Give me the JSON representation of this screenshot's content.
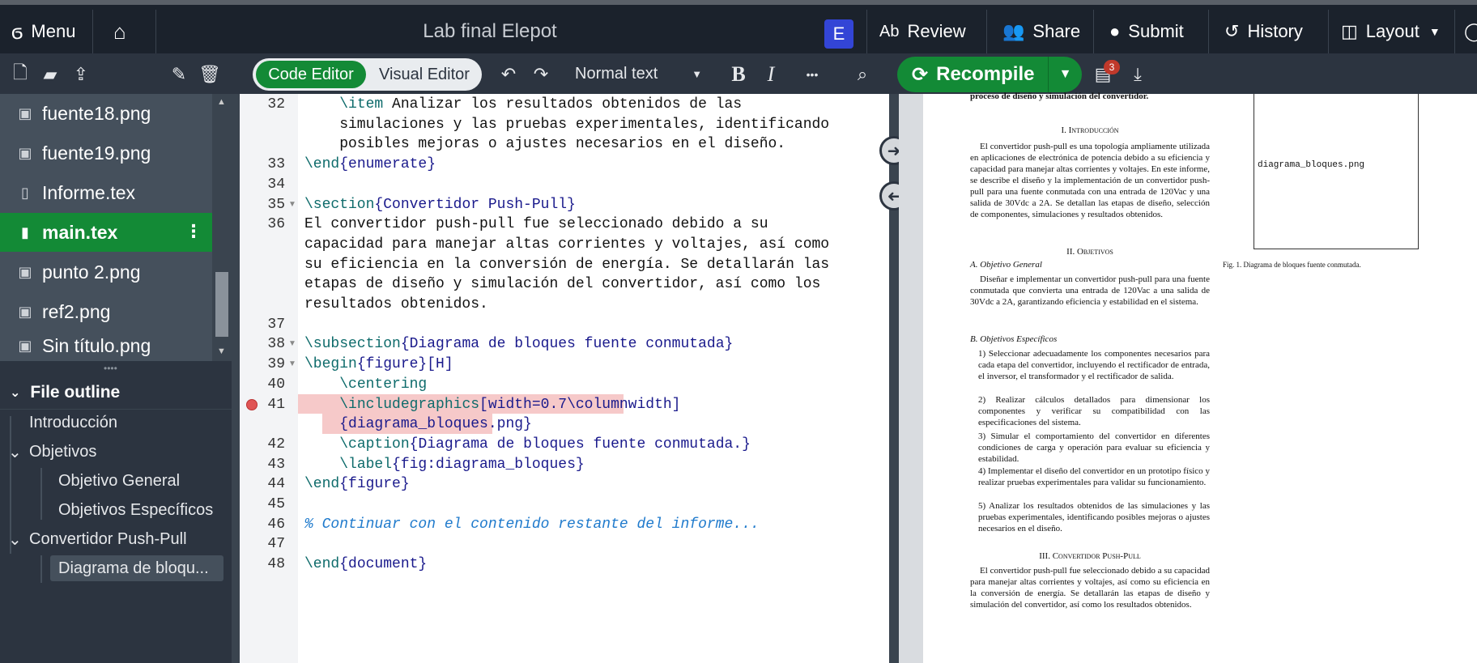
{
  "topbar": {
    "menu_label": "Menu",
    "title": "Lab final Elepot",
    "avatar_letter": "E",
    "review": "Review",
    "share": "Share",
    "submit": "Submit",
    "history": "History",
    "layout": "Layout"
  },
  "toolbar": {
    "code_editor": "Code Editor",
    "visual_editor": "Visual Editor",
    "style_select": "Normal text",
    "bold": "B",
    "italic": "I",
    "more": "•••",
    "recompile": "Recompile",
    "log_badge": "3"
  },
  "files": [
    {
      "name": "fuente18.png",
      "type": "image"
    },
    {
      "name": "fuente19.png",
      "type": "image"
    },
    {
      "name": "Informe.tex",
      "type": "doc"
    },
    {
      "name": "main.tex",
      "type": "doc",
      "selected": true
    },
    {
      "name": "punto 2.png",
      "type": "image"
    },
    {
      "name": "ref2.png",
      "type": "image"
    },
    {
      "name": "Sin título.png",
      "type": "image"
    }
  ],
  "outline": {
    "header": "File outline",
    "items": [
      {
        "label": "Introducción",
        "level": 1
      },
      {
        "label": "Objetivos",
        "level": 1
      },
      {
        "label": "Objetivo General",
        "level": 2
      },
      {
        "label": "Objetivos Específicos",
        "level": 2
      },
      {
        "label": "Convertidor Push-Pull",
        "level": 1
      },
      {
        "label": "Diagrama de bloqu...",
        "level": 2,
        "selected": true
      }
    ]
  },
  "editor": {
    "lines": [
      {
        "n": "32",
        "t1": "    ",
        "k": "\\item",
        "t2": " Analizar los resultados obtenidos de las"
      },
      {
        "n": "",
        "t1": "    simulaciones y las pruebas experimentales, identificando"
      },
      {
        "n": "",
        "t1": "    posibles mejoras o ajustes necesarios en el diseño."
      },
      {
        "n": "33",
        "k": "\\end",
        "t1": "",
        "a": "{enumerate}"
      },
      {
        "n": "34"
      },
      {
        "n": "35",
        "k": "\\section",
        "a": "{Convertidor Push-Pull}"
      },
      {
        "n": "36",
        "t1": "El convertidor push-pull fue seleccionado debido a su"
      },
      {
        "n": "",
        "t1": "capacidad para manejar altas corrientes y voltajes, así como"
      },
      {
        "n": "",
        "t1": "su eficiencia en la conversión de energía. Se detallarán las"
      },
      {
        "n": "",
        "t1": "etapas de diseño y simulación del convertidor, así como los"
      },
      {
        "n": "",
        "t1": "resultados obtenidos."
      },
      {
        "n": "37"
      },
      {
        "n": "38",
        "k": "\\subsection",
        "a": "{Diagrama de bloques fuente conmutada}"
      },
      {
        "n": "39",
        "k": "\\begin",
        "a": "{figure}[H]"
      },
      {
        "n": "40",
        "t1": "    ",
        "k": "\\centering"
      },
      {
        "n": "41",
        "t1": "    ",
        "k": "\\includegraphics",
        "a": "[width=0.7\\columnwidth]"
      },
      {
        "n": "",
        "t1": "    ",
        "a": "{diagrama_bloques.png}"
      },
      {
        "n": "42",
        "t1": "    ",
        "k": "\\caption",
        "a": "{Diagrama de bloques fuente conmutada.}"
      },
      {
        "n": "43",
        "t1": "    ",
        "k": "\\label",
        "a": "{fig:diagrama_bloques}"
      },
      {
        "n": "44",
        "k": "\\end",
        "a": "{figure}"
      },
      {
        "n": "45"
      },
      {
        "n": "46",
        "c": "% Continuar con el contenido restante del informe..."
      },
      {
        "n": "47"
      },
      {
        "n": "48",
        "k": "\\end",
        "a": "{document}"
      }
    ]
  },
  "pdf": {
    "top_line": "proceso de diseño y simulación del convertidor.",
    "fig_file": "diagrama_bloques.png",
    "fig_caption": "Fig. 1.   Diagrama de bloques fuente conmutada.",
    "sec1": "I.  Introducción",
    "intro": "El convertidor push-pull es una topología ampliamente utilizada en aplicaciones de electrónica de potencia debido a su eficiencia y capacidad para manejar altas corrientes y voltajes. En este informe, se describe el diseño y la implementación de un convertidor push-pull para una fuente conmutada con una entrada de 120Vac y una salida de 30Vdc a 2A. Se detallan las etapas de diseño, selección de componentes, simulaciones y resultados obtenidos.",
    "sec2": "II.  Objetivos",
    "subA": "A.  Objetivo General",
    "general": "Diseñar e implementar un convertidor push-pull para una fuente conmutada que convierta una entrada de 120Vac a una salida de 30Vdc a 2A, garantizando eficiencia y estabilidad en el sistema.",
    "subB": "B.  Objetivos Específicos",
    "items": [
      "1)  Seleccionar adecuadamente los componentes necesarios para cada etapa del convertidor, incluyendo el rectificador de entrada, el inversor, el transformador y el rectificador de salida.",
      "2)  Realizar cálculos detallados para dimensionar los componentes y verificar su compatibilidad con las especificaciones del sistema.",
      "3)  Simular el comportamiento del convertidor en diferentes condiciones de carga y operación para evaluar su eficiencia y estabilidad.",
      "4)  Implementar el diseño del convertidor en un prototipo físico y realizar pruebas experimentales para validar su funcionamiento.",
      "5)  Analizar los resultados obtenidos de las simulaciones y las pruebas experimentales, identificando posibles mejoras o ajustes necesarios en el diseño."
    ],
    "sec3": "III.  Convertidor Push-Pull",
    "pushpull": "El convertidor push-pull fue seleccionado debido a su capacidad para manejar altas corrientes y voltajes, así como su eficiencia en la conversión de energía. Se detallarán las etapas de diseño y simulación del convertidor, así como los resultados obtenidos."
  }
}
